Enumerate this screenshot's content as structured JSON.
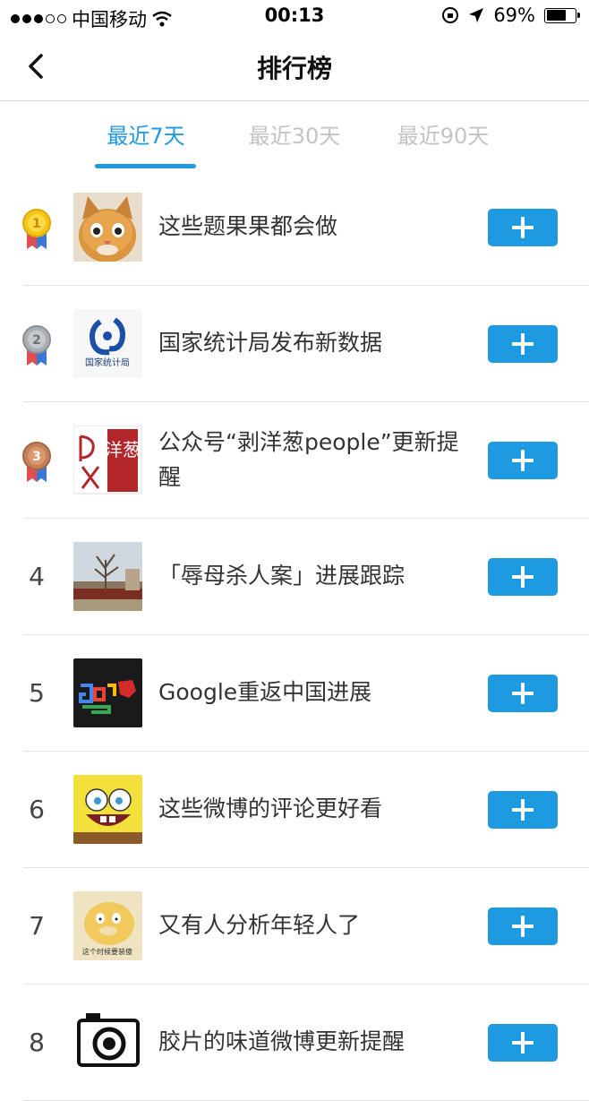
{
  "status": {
    "carrier": "中国移动",
    "time": "00:13",
    "battery_pct": "69%",
    "battery_level": 0.69
  },
  "nav": {
    "title": "排行榜",
    "back_icon": "chevron-left-icon"
  },
  "tabs": [
    {
      "label": "最近7天",
      "active": true
    },
    {
      "label": "最近30天",
      "active": false
    },
    {
      "label": "最近90天",
      "active": false
    }
  ],
  "colors": {
    "accent": "#1e9ae0",
    "gold": "#f0b400",
    "silver": "#9ea3a8",
    "bronze": "#c4805a"
  },
  "items": [
    {
      "rank": "1",
      "title": "这些题果果都会做",
      "thumb": "cat-photo"
    },
    {
      "rank": "2",
      "title": "国家统计局发布新数据",
      "thumb": "stats-bureau-logo",
      "logo_text": "国家统计局"
    },
    {
      "rank": "3",
      "title": "公众号“剥洋葱people”更新提醒",
      "thumb": "onion-people-logo",
      "logo_text": "洋葱"
    },
    {
      "rank": "4",
      "title": "「辱母杀人案」进展跟踪",
      "thumb": "building-photo"
    },
    {
      "rank": "5",
      "title": "Google重返中国进展",
      "thumb": "google-china-image"
    },
    {
      "rank": "6",
      "title": "这些微博的评论更好看",
      "thumb": "spongebob-image"
    },
    {
      "rank": "7",
      "title": "又有人分析年轻人了",
      "thumb": "psyduck-image",
      "caption": "这个时候要装傻"
    },
    {
      "rank": "8",
      "title": "胶片的味道微博更新提醒",
      "thumb": "camera-image"
    }
  ],
  "add_icon": "plus-icon"
}
